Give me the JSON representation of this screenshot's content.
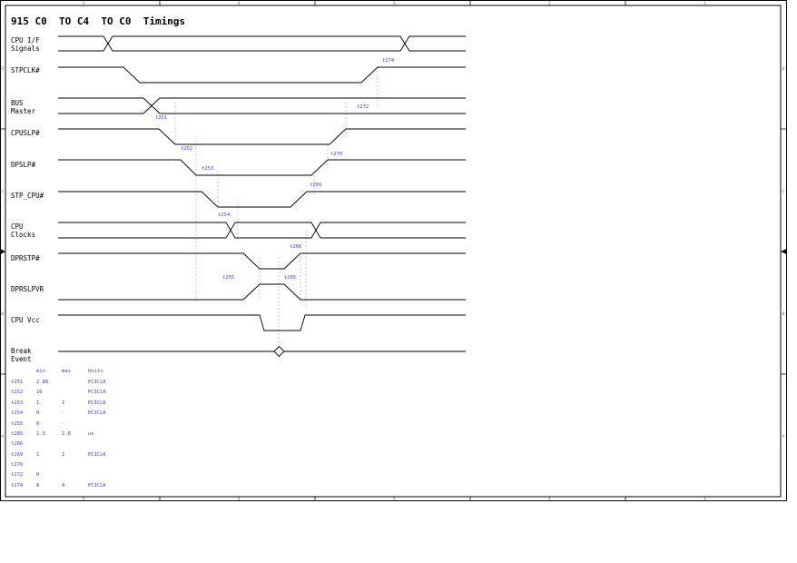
{
  "title": "915 C0  TO C4  TO C0  Timings",
  "colors": {
    "line": "#000000",
    "annot": "#3b3bd1",
    "guide": "#ef8fb0"
  },
  "signals": [
    {
      "id": "cpu-if-signals",
      "label": [
        "CPU I/F",
        "Signals"
      ]
    },
    {
      "id": "stpclk",
      "label": [
        "STPCLK#"
      ]
    },
    {
      "id": "bus-master",
      "label": [
        "BUS",
        "Master"
      ]
    },
    {
      "id": "cpuslp",
      "label": [
        "CPUSLP#"
      ]
    },
    {
      "id": "dpslp",
      "label": [
        "DPSLP#"
      ]
    },
    {
      "id": "stp-cpu",
      "label": [
        "STP_CPU#"
      ]
    },
    {
      "id": "cpu-clocks",
      "label": [
        "CPU",
        "Clocks"
      ]
    },
    {
      "id": "dprstp",
      "label": [
        "DPRSTP#"
      ]
    },
    {
      "id": "dprslpvr",
      "label": [
        "DPRSLPVR"
      ]
    },
    {
      "id": "cpu-vcc",
      "label": [
        "CPU Vcc"
      ]
    },
    {
      "id": "break-event",
      "label": [
        "Break",
        "Event"
      ]
    }
  ],
  "timing_labels": [
    "t274",
    "t251",
    "t272",
    "t252",
    "t270",
    "t253",
    "t269",
    "t254",
    "t266",
    "t255",
    "t265"
  ],
  "table": {
    "headers": [
      "min",
      "max",
      "Units"
    ],
    "rows": [
      {
        "name": "t251",
        "min": "2.88",
        "max": "",
        "units": "PCICLK"
      },
      {
        "name": "t252",
        "min": "16",
        "max": "",
        "units": "PCICLK"
      },
      {
        "name": "t253",
        "min": "1",
        "max": "1",
        "units": "PCICLK"
      },
      {
        "name": "t254",
        "min": "0",
        "max": "-",
        "units": "PCICLK"
      },
      {
        "name": "t255",
        "min": "0",
        "max": "-",
        "units": ""
      },
      {
        "name": "t265",
        "min": "1.5",
        "max": "1.8",
        "units": "us"
      },
      {
        "name": "t266",
        "min": "",
        "max": "",
        "units": ""
      },
      {
        "name": "t269",
        "min": "1",
        "max": "1",
        "units": "PCICLK"
      },
      {
        "name": "t270",
        "min": "",
        "max": "",
        "units": ""
      },
      {
        "name": "t272",
        "min": "0",
        "max": "",
        "units": ""
      },
      {
        "name": "t274",
        "min": "8",
        "max": "9",
        "units": "PCICLK"
      }
    ]
  },
  "border_zones": {
    "top": [
      "5",
      "4",
      "3",
      "2",
      "1"
    ],
    "bottom": [
      "5",
      "4",
      "3",
      "2",
      "1"
    ],
    "left": [
      "D",
      "C",
      "B",
      "A"
    ],
    "right": [
      "D",
      "C",
      "B",
      "A"
    ]
  }
}
